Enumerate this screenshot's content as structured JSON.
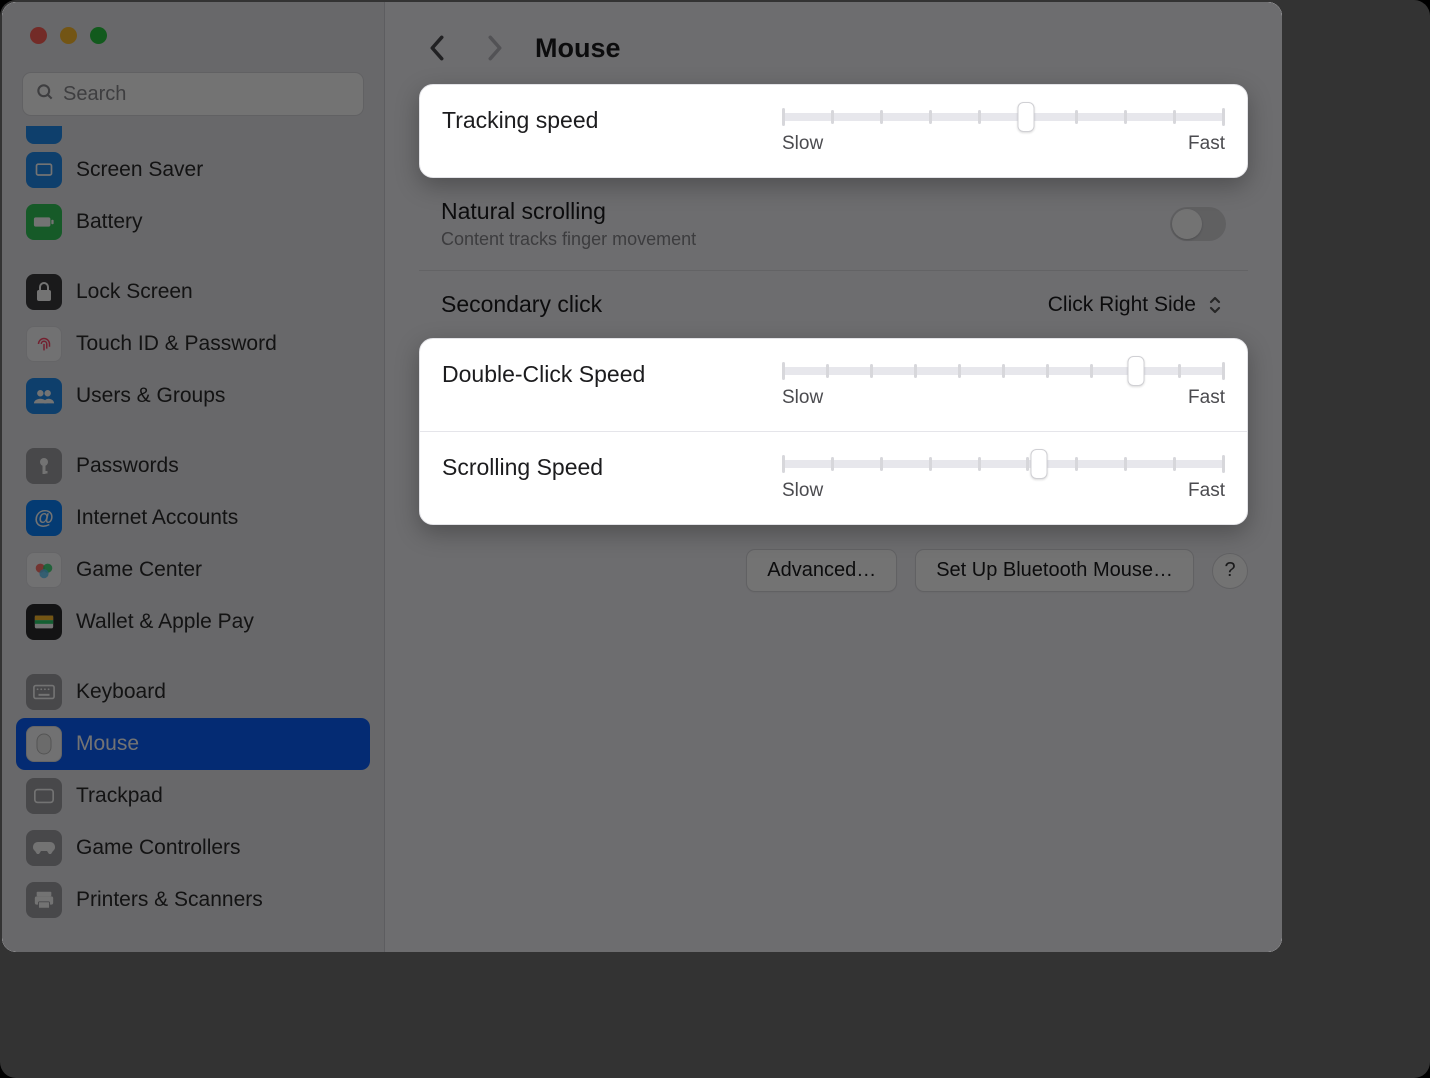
{
  "window": {
    "search_placeholder": "Search"
  },
  "header": {
    "title": "Mouse"
  },
  "sidebar": {
    "items": [
      {
        "label": "Screen Saver"
      },
      {
        "label": "Battery"
      },
      {
        "label": "Lock Screen"
      },
      {
        "label": "Touch ID & Password"
      },
      {
        "label": "Users & Groups"
      },
      {
        "label": "Passwords"
      },
      {
        "label": "Internet Accounts"
      },
      {
        "label": "Game Center"
      },
      {
        "label": "Wallet & Apple Pay"
      },
      {
        "label": "Keyboard"
      },
      {
        "label": "Mouse"
      },
      {
        "label": "Trackpad"
      },
      {
        "label": "Game Controllers"
      },
      {
        "label": "Printers & Scanners"
      }
    ]
  },
  "settings": {
    "tracking": {
      "label": "Tracking speed",
      "low": "Slow",
      "high": "Fast",
      "ticks": 10,
      "position_pct": 55
    },
    "natural_scroll": {
      "label": "Natural scrolling",
      "sub": "Content tracks finger movement",
      "on": false
    },
    "secondary_click": {
      "label": "Secondary click",
      "value": "Click Right Side"
    },
    "double_click": {
      "label": "Double-Click Speed",
      "low": "Slow",
      "high": "Fast",
      "ticks": 11,
      "position_pct": 80
    },
    "scrolling": {
      "label": "Scrolling Speed",
      "low": "Slow",
      "high": "Fast",
      "ticks": 10,
      "position_pct": 58
    }
  },
  "buttons": {
    "advanced": "Advanced…",
    "bluetooth": "Set Up Bluetooth Mouse…",
    "help": "?"
  }
}
